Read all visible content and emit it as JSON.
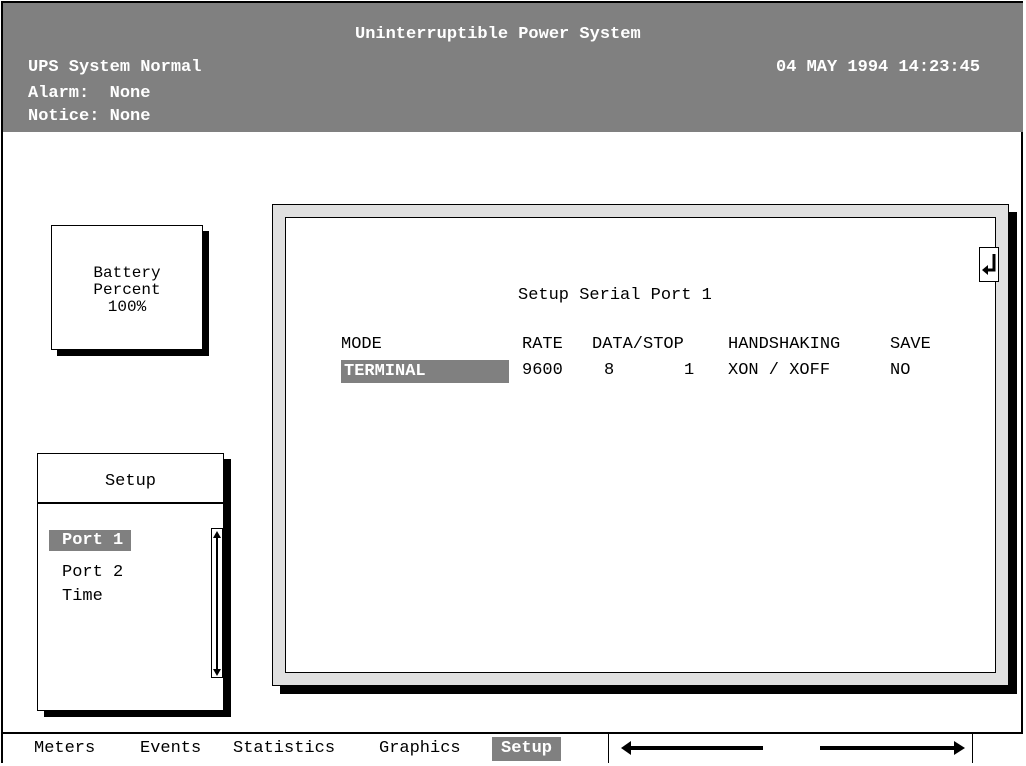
{
  "header": {
    "title": "Uninterruptible Power System",
    "status": "UPS System Normal",
    "datetime": "04 MAY 1994 14:23:45",
    "alarm": "Alarm:  None",
    "notice": "Notice: None"
  },
  "battery": {
    "line1": "Battery",
    "line2": "Percent",
    "value": "100%"
  },
  "setup_menu": {
    "title": "Setup",
    "items": [
      {
        "label": "Port 1",
        "selected": true
      },
      {
        "label": "Port 2",
        "selected": false
      },
      {
        "label": "Time",
        "selected": false
      }
    ]
  },
  "dialog": {
    "title": "Setup Serial Port 1",
    "headers": {
      "mode": "MODE",
      "rate": "RATE",
      "data_stop": "DATA/STOP",
      "handshaking": "HANDSHAKING",
      "save": "SAVE"
    },
    "values": {
      "mode": "TERMINAL",
      "rate": "9600",
      "data": "8",
      "stop": "1",
      "handshaking": "XON / XOFF",
      "save": "NO"
    }
  },
  "bottom_menu": {
    "tabs": [
      "Meters",
      "Events",
      "Statistics",
      "Graphics",
      "Setup"
    ],
    "active": "Setup"
  },
  "icons": {
    "enter": "enter-return-icon",
    "scroll_up": "arrow-up-icon",
    "scroll_down": "arrow-down-icon",
    "nav_left": "arrow-left-icon",
    "nav_right": "arrow-right-icon"
  },
  "colors": {
    "header_bg": "#808080",
    "highlight_bg": "#808080",
    "dialog_border": "#e0e0e0"
  }
}
